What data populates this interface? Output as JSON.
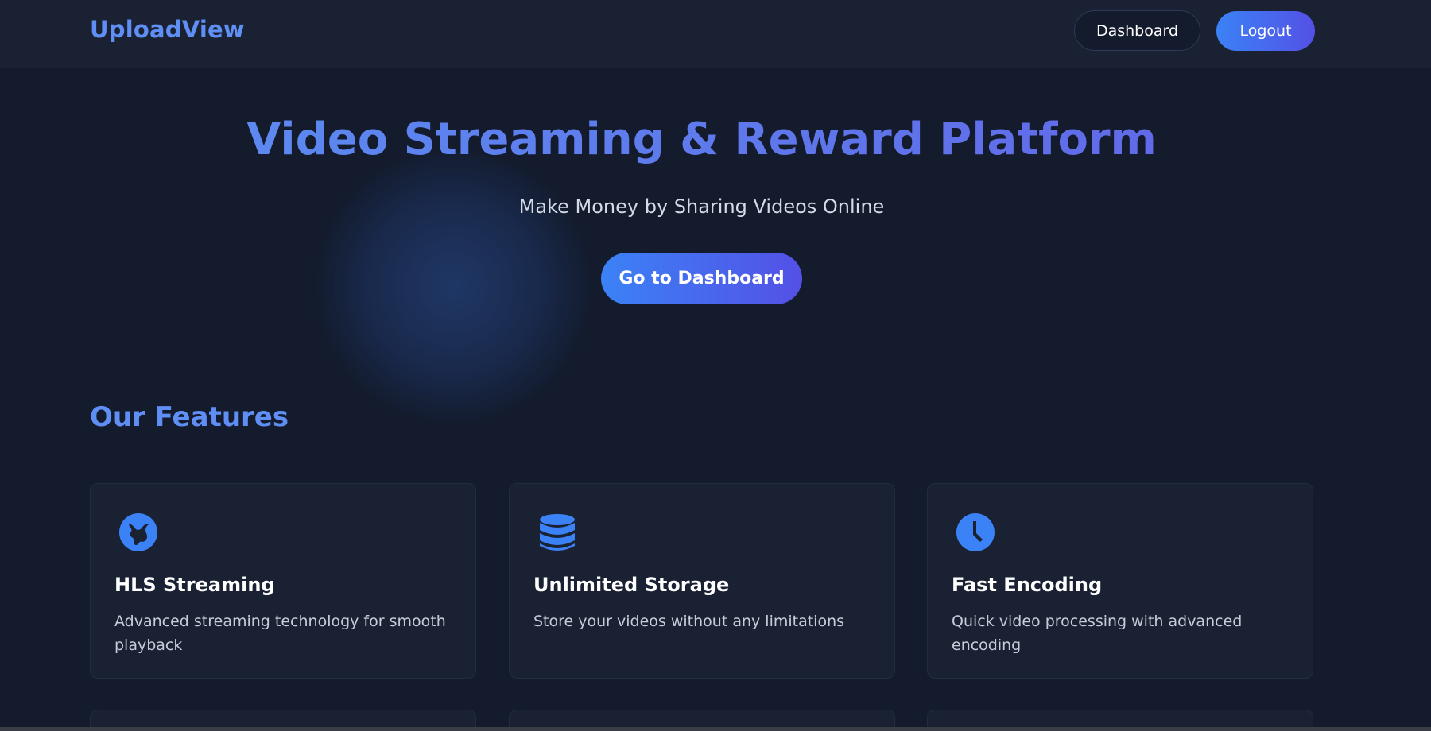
{
  "navbar": {
    "brand": "UploadView",
    "dashboard_label": "Dashboard",
    "logout_label": "Logout"
  },
  "hero": {
    "title": "Video Streaming & Reward Platform",
    "subtitle": "Make Money by Sharing Videos Online",
    "cta_label": "Go to Dashboard"
  },
  "features": {
    "heading": "Our Features",
    "items": [
      {
        "icon": "streaming-globe-icon",
        "title": "HLS Streaming",
        "description": "Advanced streaming technology for smooth playback"
      },
      {
        "icon": "database-icon",
        "title": "Unlimited Storage",
        "description": "Store your videos without any limitations"
      },
      {
        "icon": "clock-icon",
        "title": "Fast Encoding",
        "description": "Quick video processing with advanced encoding"
      }
    ]
  },
  "colors": {
    "background": "#131b2d",
    "surface": "#1a2133",
    "accent_blue": "#3b82f6",
    "accent_indigo": "#5450e6",
    "brand_text": "#5f8ef4"
  }
}
